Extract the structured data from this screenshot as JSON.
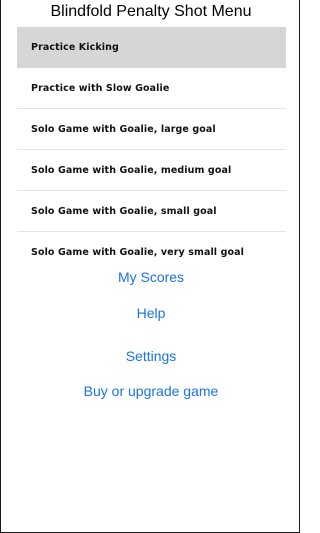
{
  "header": {
    "title": "Blindfold Penalty Shot Menu"
  },
  "menu": {
    "items": [
      {
        "label": "Practice Kicking",
        "selected": true
      },
      {
        "label": "Practice with Slow Goalie",
        "selected": false
      },
      {
        "label": "Solo Game with Goalie, large goal",
        "selected": false
      },
      {
        "label": "Solo Game with Goalie, medium goal",
        "selected": false
      },
      {
        "label": "Solo Game with Goalie, small goal",
        "selected": false
      },
      {
        "label": "Solo Game with Goalie, very small goal",
        "selected": false
      }
    ]
  },
  "links": {
    "my_scores": "My Scores",
    "help": "Help",
    "settings": "Settings",
    "buy_upgrade": "Buy or upgrade game"
  },
  "colors": {
    "link": "#1a73e8",
    "selected_row": "#d6d6d6"
  }
}
